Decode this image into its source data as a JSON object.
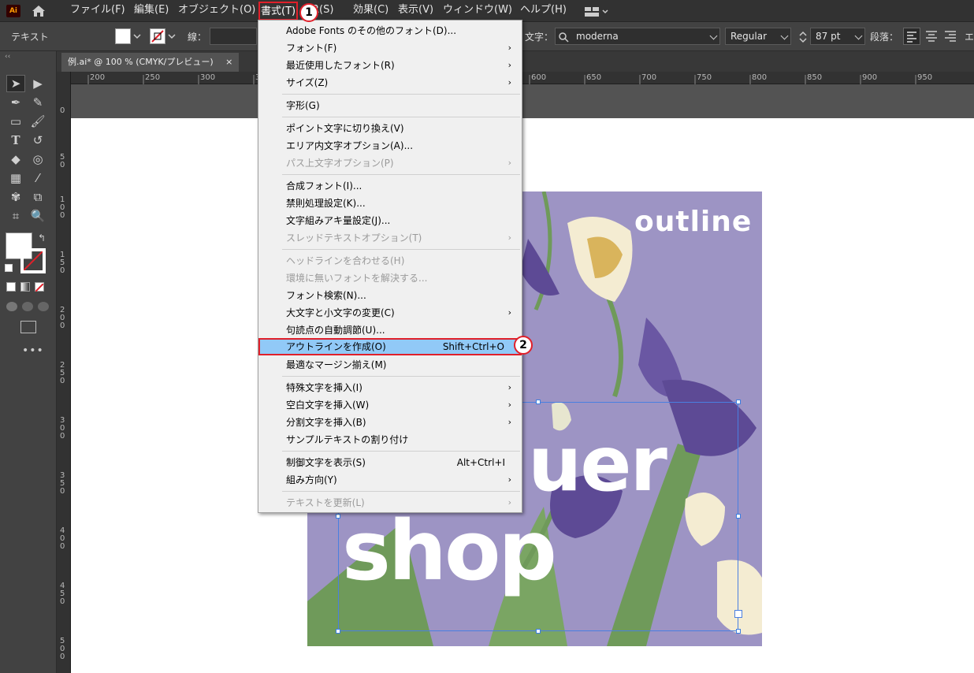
{
  "menubar": {
    "logo": "Ai",
    "items": [
      "ファイル(F)",
      "編集(E)",
      "オブジェクト(O)",
      "書式(T)",
      "選択(S)",
      "効果(C)",
      "表示(V)",
      "ウィンドウ(W)",
      "ヘルプ(H)"
    ],
    "visible_fragment": "R(S)"
  },
  "control": {
    "label": "テキスト",
    "stroke_label": "線：",
    "char_label": "文字：",
    "font": "moderna",
    "style": "Regular",
    "size": "87 pt",
    "para_label": "段落：",
    "extra": "エ"
  },
  "tab": {
    "title": "例.ai* @ 100 % (CMYK/プレビュー)",
    "close": "×"
  },
  "ruler": {
    "h": [
      "200",
      "250",
      "300",
      "3",
      "600",
      "650",
      "700",
      "750",
      "800",
      "850",
      "900",
      "950"
    ],
    "v": [
      "0",
      "5 0",
      "1 0 0",
      "1 5 0",
      "2 0 0",
      "2 5 0",
      "3 0 0",
      "3 5 0",
      "4 0 0",
      "4 5 0",
      "5 0 0"
    ]
  },
  "artwork": {
    "outline": "outline",
    "uer": "uer",
    "shop": "shop",
    "bg": "#9d94c4"
  },
  "menu": {
    "items": [
      {
        "label": "Adobe Fonts のその他のフォント(D)...",
        "arrow": "",
        "shortcut": ""
      },
      {
        "label": "フォント(F)",
        "arrow": "›",
        "shortcut": ""
      },
      {
        "label": "最近使用したフォント(R)",
        "arrow": "›",
        "shortcut": ""
      },
      {
        "label": "サイズ(Z)",
        "arrow": "›",
        "shortcut": ""
      },
      {
        "label": "字形(G)",
        "arrow": "",
        "shortcut": ""
      },
      {
        "label": "ポイント文字に切り換え(V)",
        "arrow": "",
        "shortcut": ""
      },
      {
        "label": "エリア内文字オプション(A)...",
        "arrow": "",
        "shortcut": ""
      },
      {
        "label": "パス上文字オプション(P)",
        "arrow": "›",
        "shortcut": ""
      },
      {
        "label": "合成フォント(I)...",
        "arrow": "",
        "shortcut": ""
      },
      {
        "label": "禁則処理設定(K)...",
        "arrow": "",
        "shortcut": ""
      },
      {
        "label": "文字組みアキ量設定(J)...",
        "arrow": "",
        "shortcut": ""
      },
      {
        "label": "スレッドテキストオプション(T)",
        "arrow": "›",
        "shortcut": ""
      },
      {
        "label": "ヘッドラインを合わせる(H)",
        "arrow": "",
        "shortcut": ""
      },
      {
        "label": "環境に無いフォントを解決する...",
        "arrow": "",
        "shortcut": ""
      },
      {
        "label": "フォント検索(N)...",
        "arrow": "",
        "shortcut": ""
      },
      {
        "label": "大文字と小文字の変更(C)",
        "arrow": "›",
        "shortcut": ""
      },
      {
        "label": "句読点の自動調節(U)...",
        "arrow": "",
        "shortcut": ""
      },
      {
        "label": "アウトラインを作成(O)",
        "arrow": "",
        "shortcut": "Shift+Ctrl+O"
      },
      {
        "label": "最適なマージン揃え(M)",
        "arrow": "",
        "shortcut": ""
      },
      {
        "label": "特殊文字を挿入(I)",
        "arrow": "›",
        "shortcut": ""
      },
      {
        "label": "空白文字を挿入(W)",
        "arrow": "›",
        "shortcut": ""
      },
      {
        "label": "分割文字を挿入(B)",
        "arrow": "›",
        "shortcut": ""
      },
      {
        "label": "サンプルテキストの割り付け",
        "arrow": "",
        "shortcut": ""
      },
      {
        "label": "制御文字を表示(S)",
        "arrow": "",
        "shortcut": "Alt+Ctrl+I"
      },
      {
        "label": "組み方向(Y)",
        "arrow": "›",
        "shortcut": ""
      },
      {
        "label": "テキストを更新(L)",
        "arrow": "›",
        "shortcut": ""
      }
    ]
  },
  "badges": {
    "one": "1",
    "two": "2"
  },
  "colors": {
    "highlight": "#91c9f7",
    "callout": "#e0202a",
    "accent": "#ff9a00"
  }
}
